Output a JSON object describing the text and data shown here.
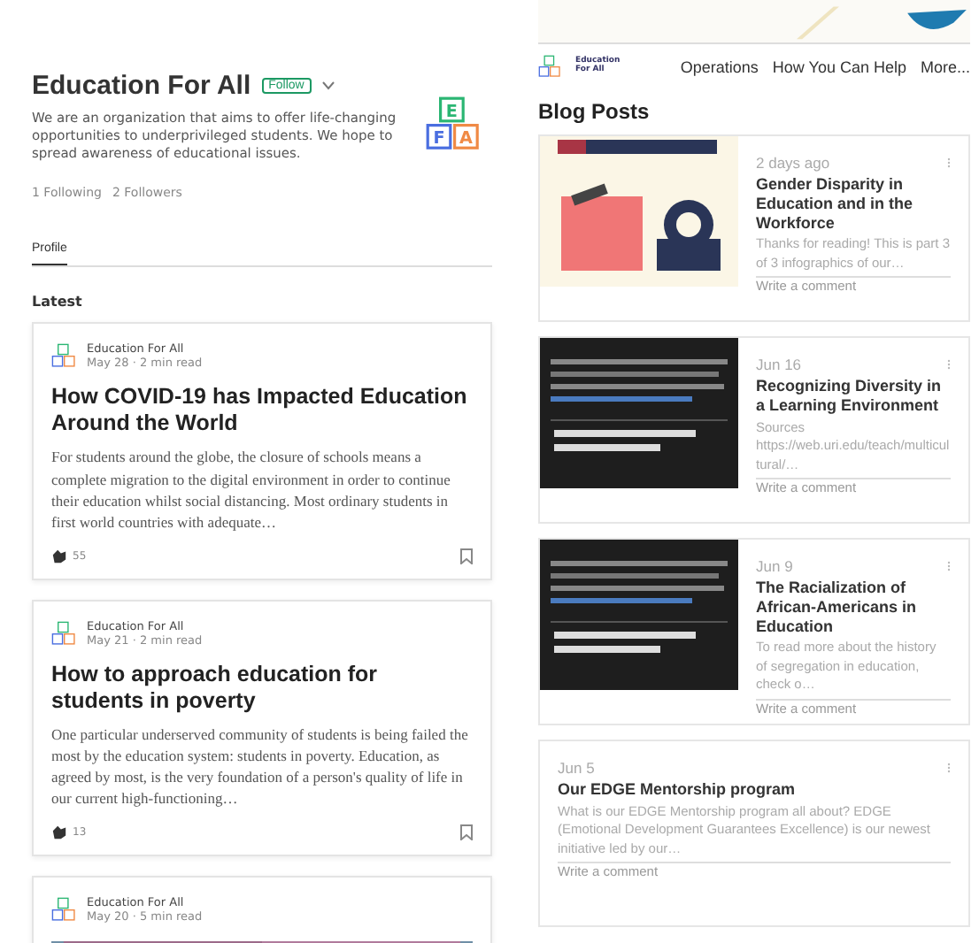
{
  "profile": {
    "name": "Education For All",
    "follow_button": "Follow",
    "description": "We are an organization that aims to offer life-changing opportunities to underprivileged students. We hope to spread awareness of educational issues.",
    "following": "1 Following",
    "followers": "2 Followers",
    "logo_letters": [
      "E",
      "F",
      "A"
    ]
  },
  "profile_tabs": [
    {
      "label": "Profile",
      "selected": true
    }
  ],
  "section_title": "Latest",
  "stories": [
    {
      "author": "Education For All",
      "meta": "May 28 · 2 min read",
      "title": "How COVID-19 has Impacted Education Around the World",
      "excerpt": "For students around the globe, the closure of schools means a complete migration to the digital environment in order to continue their education whilst social distancing. Most ordinary students in first world countries with adequate…",
      "claps": "55"
    },
    {
      "author": "Education For All",
      "meta": "May 21 · 2 min read",
      "title": "How to approach education for students in poverty",
      "excerpt": "One particular underserved community of students is being failed the most by the education system: students in poverty. Education, as agreed by most, is the very foundation of a person's quality of life in our current high-functioning…",
      "claps": "13"
    },
    {
      "author": "Education For All",
      "meta": "May 20 · 5 min read",
      "kind": "picture"
    }
  ],
  "site": {
    "logo_text": "Education For All",
    "nav": [
      "Operations",
      "How You Can Help",
      "More..."
    ]
  },
  "blog_title": "Blog Posts",
  "posts": [
    {
      "kind": "light",
      "date": "2 days ago",
      "title": "Gender Disparity in Education and in the Workforce",
      "excerpt": "Thanks for reading! This is part 3 of 3 infographics of our…",
      "comment": "Write a comment"
    },
    {
      "kind": "dark",
      "date": "Jun 16",
      "title": "Recognizing Diversity in a Learning Environment",
      "excerpt": "Sources https://web.uri.edu/teach/multicultural/…",
      "comment": "Write a comment"
    },
    {
      "kind": "dark",
      "date": "Jun 9",
      "title": "The Racialization of African-Americans in Education",
      "excerpt": "To read more about the history of segregation in education, check o…",
      "comment": "Write a comment"
    },
    {
      "kind": "text",
      "date": "Jun 5",
      "title": "Our EDGE Mentorship program",
      "excerpt": "What is our EDGE Mentorship program all about? EDGE (Emotional Development Guarantees Excellence) is our newest initiative led by our…",
      "comment": "Write a comment"
    }
  ]
}
